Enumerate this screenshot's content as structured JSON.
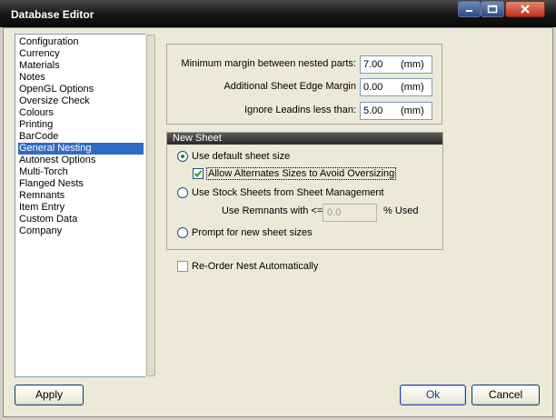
{
  "window": {
    "title": "Database Editor"
  },
  "sidebar": {
    "items": [
      {
        "label": "Configuration",
        "selected": false
      },
      {
        "label": "Currency",
        "selected": false
      },
      {
        "label": "Materials",
        "selected": false
      },
      {
        "label": "Notes",
        "selected": false
      },
      {
        "label": "OpenGL Options",
        "selected": false
      },
      {
        "label": "Oversize Check",
        "selected": false
      },
      {
        "label": "Colours",
        "selected": false
      },
      {
        "label": "Printing",
        "selected": false
      },
      {
        "label": "BarCode",
        "selected": false
      },
      {
        "label": "General Nesting",
        "selected": true
      },
      {
        "label": "Autonest Options",
        "selected": false
      },
      {
        "label": "Multi-Torch",
        "selected": false
      },
      {
        "label": "Flanged Nests",
        "selected": false
      },
      {
        "label": "Remnants",
        "selected": false
      },
      {
        "label": "Item Entry",
        "selected": false
      },
      {
        "label": "Custom Data",
        "selected": false
      },
      {
        "label": "Company",
        "selected": false
      }
    ]
  },
  "margins": {
    "min_margin_label": "Minimum margin between nested parts:",
    "min_margin_value": "7.00",
    "edge_margin_label": "Additional Sheet Edge Margin",
    "edge_margin_value": "0.00",
    "leadins_label": "Ignore Leadins less than:",
    "leadins_value": "5.00",
    "unit": "(mm)"
  },
  "new_sheet": {
    "header": "New Sheet",
    "default_size_label": "Use default sheet size",
    "default_size_selected": true,
    "alternates_label": "Allow Alternates Sizes to Avoid Oversizing",
    "alternates_checked": true,
    "stock_sheets_label": "Use Stock Sheets from Sheet Management",
    "stock_sheets_selected": false,
    "remnants_label": "Use Remnants with <=",
    "remnants_value": "0.0",
    "remnants_unit": "% Used",
    "prompt_label": "Prompt for new sheet sizes",
    "prompt_selected": false
  },
  "reorder": {
    "label": "Re-Order Nest Automatically",
    "checked": false
  },
  "buttons": {
    "apply": "Apply",
    "ok": "Ok",
    "cancel": "Cancel"
  },
  "colors": {
    "selection": "#316ac5",
    "titlebar": "#141414",
    "dialog_bg": "#ece9d8"
  }
}
